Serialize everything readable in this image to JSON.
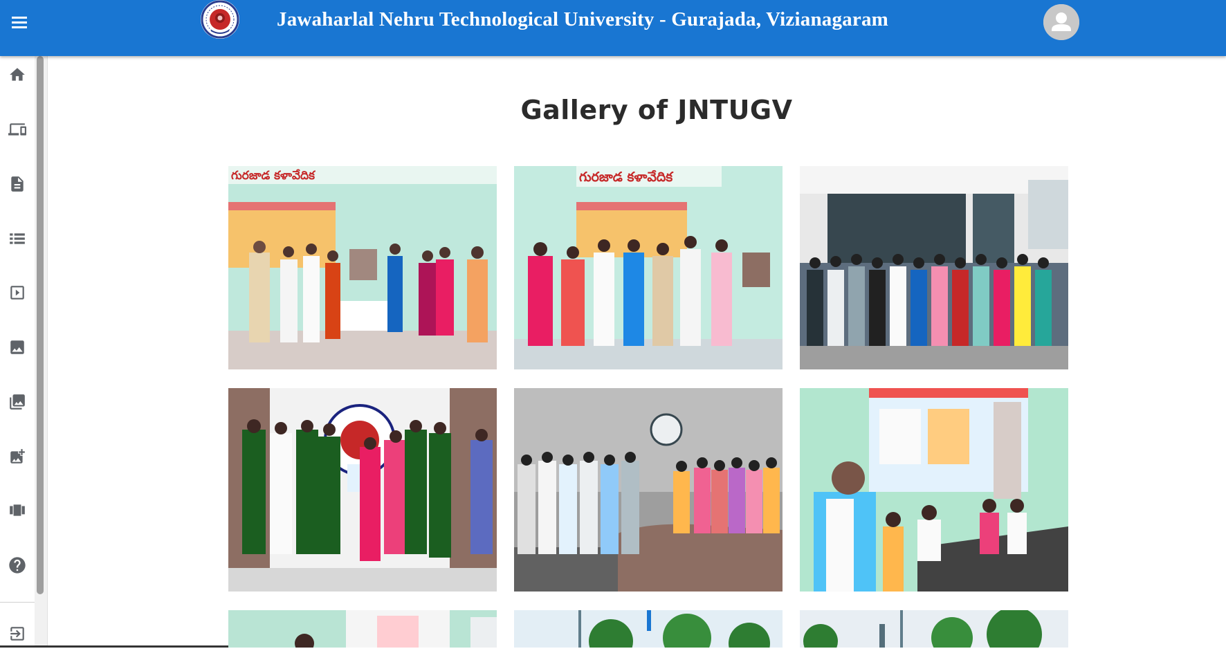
{
  "header": {
    "title": "Jawaharlal Nehru Technological University - Gurajada, Vizianagaram",
    "menu_icon": "menu-icon",
    "avatar_icon": "account-circle-icon"
  },
  "sidebar": {
    "items": [
      {
        "icon": "home-icon"
      },
      {
        "icon": "devices-icon"
      },
      {
        "icon": "description-icon"
      },
      {
        "icon": "list-icon"
      },
      {
        "icon": "slideshow-icon"
      },
      {
        "icon": "image-icon"
      },
      {
        "icon": "collections-icon"
      },
      {
        "icon": "add-photo-icon"
      },
      {
        "icon": "view-carousel-icon"
      },
      {
        "icon": "help-icon"
      }
    ],
    "logout_icon": "logout-icon"
  },
  "main": {
    "title": "Gallery of JNTUGV",
    "photos": [
      {
        "banner": "గురజాడ కళావేదిక"
      },
      {
        "banner": "గురజాడ కళావేదిక"
      },
      {
        "banner": ""
      },
      {
        "banner": ""
      },
      {
        "banner": ""
      },
      {
        "banner": ""
      },
      {
        "banner": ""
      },
      {
        "banner": ""
      },
      {
        "banner": ""
      }
    ]
  },
  "colors": {
    "header_bg": "#1976d2",
    "icon_gray": "#5f6368",
    "title_text": "#2b2b2b"
  }
}
